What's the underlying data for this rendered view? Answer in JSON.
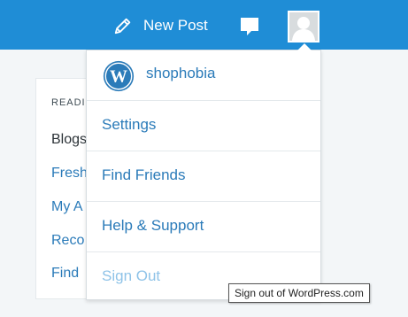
{
  "masterbar": {
    "new_post_label": "New Post",
    "icons": {
      "new_post": "pencil-icon",
      "notifications": "speech-bubble-icon",
      "profile": "avatar"
    },
    "colors": {
      "bar": "#1f8dd6",
      "icon": "#ffffff"
    }
  },
  "reader": {
    "heading": "READI",
    "items": [
      {
        "label": "Blogs"
      },
      {
        "label": "Fresh"
      },
      {
        "label": "My A"
      },
      {
        "label": "Reco"
      },
      {
        "label": "Find"
      }
    ]
  },
  "profile_menu": {
    "site_name": "shophobia",
    "site_icon": "wordpress-logo",
    "items": [
      {
        "label": "Settings"
      },
      {
        "label": "Find Friends"
      },
      {
        "label": "Help & Support"
      },
      {
        "label": "Sign Out"
      }
    ],
    "colors": {
      "link": "#2b7bb9",
      "hovered_link": "#8fc3e8"
    }
  },
  "tooltip": {
    "text": "Sign out of WordPress.com"
  }
}
